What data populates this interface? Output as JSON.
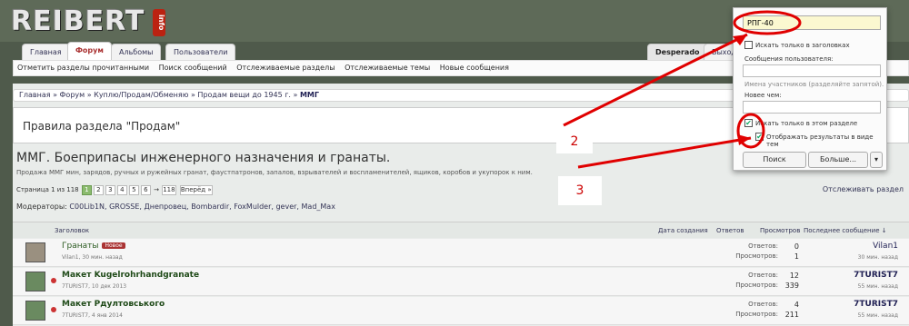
{
  "logo": {
    "text": "REIBERT",
    "sub": "info"
  },
  "tabs": [
    "Главная",
    "Форум",
    "Альбомы",
    "Пользователи",
    "Desperado",
    "Выход"
  ],
  "subnav": [
    "Отметить разделы прочитанными",
    "Поиск сообщений",
    "Отслеживаемые разделы",
    "Отслеживаемые темы",
    "Новые сообщения"
  ],
  "breadcrumb": {
    "items": "Главная » Форум » Куплю/Продам/Обменяю » Продам вещи до 1945 г. »",
    "last": "ММГ"
  },
  "rules": "Правила раздела \"Продам\"",
  "section": {
    "title": "ММГ. Боеприпасы инженерного назначения и гранаты.",
    "desc": "Продажа ММГ мин, зарядов, ручных и ружейных гранат, фаустпатронов, запалов, взрывателей и воспламенителей, ящиков, коробов и укупорок к ним."
  },
  "pagination": {
    "label": "Страница 1 из 118",
    "pages": [
      "1",
      "2",
      "3",
      "4",
      "5",
      "6",
      "→",
      "118"
    ],
    "next": "Вперёд »"
  },
  "follow": "Отслеживать раздел",
  "moderators": {
    "label": "Модераторы:",
    "names": "C00Lib1N, GROSSE, Днепровец, Bombardir, FoxMulder, gever, Mad_Max"
  },
  "table_header": {
    "topic": "Заголовок",
    "created": "Дата создания",
    "replies": "Ответов",
    "views": "Просмотров",
    "last": "Последнее сообщение ↓"
  },
  "threads": [
    {
      "title": "Гранаты",
      "badge": "Новое",
      "meta": "Vilan1, 30 мин. назад",
      "replies": "0",
      "views": "1",
      "last_user": "Vilan1",
      "last_time": "30 мин. назад"
    },
    {
      "title": "Макет Kugelrohrhandgranate",
      "badge": "",
      "meta": "7TURIST7, 10 дек 2013",
      "replies": "12",
      "views": "339",
      "last_user": "7TURIST7",
      "last_time": "55 мин. назад"
    },
    {
      "title": "Макет Рдултовського",
      "badge": "",
      "meta": "7TURIST7, 4 янв 2014",
      "replies": "4",
      "views": "211",
      "last_user": "7TURIST7",
      "last_time": "55 мин. назад"
    }
  ],
  "row_labels": {
    "replies": "Ответов:",
    "views": "Просмотров:"
  },
  "search": {
    "query": "РПГ-40",
    "titles_only": "Искать только в заголовках",
    "user_msgs": "Сообщения пользователя:",
    "names_hint": "Имена участников (разделяйте запятой).",
    "newer": "Новее чем:",
    "this_section": "Искать только в этом разделе",
    "as_threads": "Отображать результаты в виде тем",
    "search_btn": "Поиск",
    "more_btn": "Больше..."
  },
  "annotations": [
    "2",
    "3"
  ],
  "colors": {
    "accent": "#8bbb6e",
    "annotation": "#e00000"
  }
}
